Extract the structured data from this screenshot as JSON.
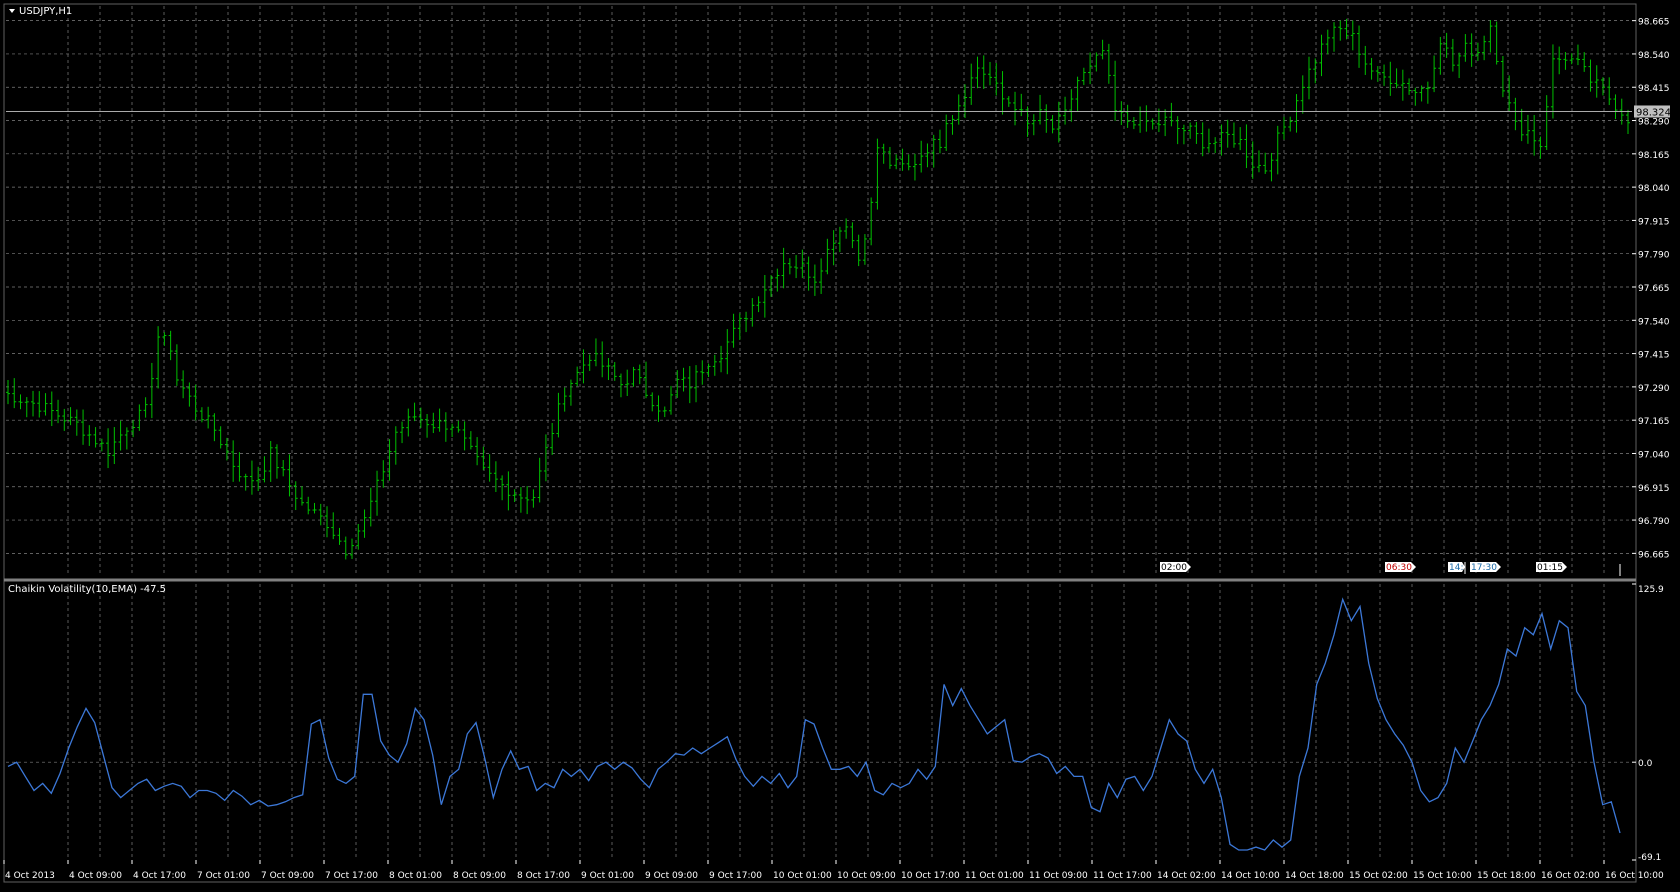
{
  "colors": {
    "background": "#000000",
    "grid": "#808080",
    "candle": "#00c000",
    "indicator": "#3c78d8",
    "text": "#ffffff",
    "bid_line": "#aaaaaa",
    "price_label_bg": "#c0c0c0"
  },
  "chart": {
    "title": "USDJPY,H1",
    "dropdown_icon": "triangle-down-icon",
    "current_price": "98.324"
  },
  "events": [
    "02:00",
    "06:30",
    "14:",
    "17:30",
    "01:15"
  ],
  "indicator": {
    "title": "Chaikin Volatility(10,EMA) -47.5"
  },
  "chart_data": [
    {
      "type": "bar",
      "title": "USDJPY,H1",
      "xlabel": "",
      "ylabel": "",
      "ylim": [
        96.58,
        98.72
      ],
      "y_ticks": [
        "98.665",
        "98.540",
        "98.415",
        "98.290",
        "98.165",
        "98.040",
        "97.915",
        "97.790",
        "97.665",
        "97.540",
        "97.415",
        "97.290",
        "97.165",
        "97.040",
        "96.915",
        "96.790",
        "96.665"
      ],
      "x_ticks": [
        "4 Oct 2013",
        "4 Oct 09:00",
        "4 Oct 17:00",
        "7 Oct 01:00",
        "7 Oct 09:00",
        "7 Oct 17:00",
        "8 Oct 01:00",
        "8 Oct 09:00",
        "8 Oct 17:00",
        "9 Oct 01:00",
        "9 Oct 09:00",
        "9 Oct 17:00",
        "10 Oct 01:00",
        "10 Oct 09:00",
        "10 Oct 17:00",
        "11 Oct 01:00",
        "11 Oct 09:00",
        "11 Oct 17:00",
        "14 Oct 02:00",
        "14 Oct 10:00",
        "14 Oct 18:00",
        "15 Oct 02:00",
        "15 Oct 10:00",
        "15 Oct 18:00",
        "16 Oct 02:00",
        "16 Oct 10:00"
      ],
      "grid": true,
      "series": [
        {
          "name": "USDJPY,H1",
          "close_path": [
            [
              0,
              97.27
            ],
            [
              6,
              97.22
            ],
            [
              12,
              97.15
            ],
            [
              17,
              97.05
            ],
            [
              20,
              97.14
            ],
            [
              23,
              97.2
            ],
            [
              25,
              97.48
            ],
            [
              27,
              97.44
            ],
            [
              28,
              97.32
            ],
            [
              31,
              97.21
            ],
            [
              34,
              97.13
            ],
            [
              37,
              97.0
            ],
            [
              39,
              96.94
            ],
            [
              41,
              96.95
            ],
            [
              43,
              97.04
            ],
            [
              46,
              96.92
            ],
            [
              48,
              96.85
            ],
            [
              52,
              96.78
            ],
            [
              55,
              96.68
            ],
            [
              58,
              96.79
            ],
            [
              61,
              96.98
            ],
            [
              63,
              97.12
            ],
            [
              66,
              97.18
            ],
            [
              69,
              97.15
            ],
            [
              72,
              97.15
            ],
            [
              74,
              97.08
            ],
            [
              77,
              96.97
            ],
            [
              80,
              96.92
            ],
            [
              83,
              96.88
            ],
            [
              85,
              96.88
            ],
            [
              87,
              97.05
            ],
            [
              90,
              97.28
            ],
            [
              92,
              97.34
            ],
            [
              94,
              97.41
            ],
            [
              97,
              97.35
            ],
            [
              99,
              97.3
            ],
            [
              101,
              97.34
            ],
            [
              103,
              97.27
            ],
            [
              106,
              97.19
            ],
            [
              108,
              97.31
            ],
            [
              110,
              97.3
            ],
            [
              113,
              97.39
            ],
            [
              115,
              97.42
            ],
            [
              118,
              97.53
            ],
            [
              121,
              97.63
            ],
            [
              123,
              97.7
            ],
            [
              125,
              97.76
            ],
            [
              128,
              97.74
            ],
            [
              130,
              97.7
            ],
            [
              133,
              97.85
            ],
            [
              135,
              97.91
            ],
            [
              137,
              97.77
            ],
            [
              139,
              97.97
            ],
            [
              140,
              98.19
            ],
            [
              142,
              98.13
            ],
            [
              145,
              98.11
            ],
            [
              148,
              98.19
            ],
            [
              150,
              98.21
            ],
            [
              151,
              98.3
            ],
            [
              152,
              98.31
            ],
            [
              154,
              98.4
            ],
            [
              156,
              98.49
            ],
            [
              158,
              98.45
            ],
            [
              160,
              98.37
            ],
            [
              162,
              98.35
            ],
            [
              164,
              98.27
            ],
            [
              166,
              98.31
            ],
            [
              168,
              98.26
            ],
            [
              170,
              98.31
            ],
            [
              172,
              98.44
            ],
            [
              174,
              98.48
            ],
            [
              176,
              98.55
            ],
            [
              178,
              98.32
            ],
            [
              180,
              98.29
            ],
            [
              182,
              98.3
            ],
            [
              184,
              98.27
            ],
            [
              186,
              98.29
            ],
            [
              188,
              98.26
            ],
            [
              190,
              98.25
            ],
            [
              192,
              98.21
            ],
            [
              194,
              98.21
            ],
            [
              196,
              98.23
            ],
            [
              198,
              98.21
            ],
            [
              200,
              98.13
            ],
            [
              202,
              98.11
            ],
            [
              204,
              98.22
            ],
            [
              206,
              98.31
            ],
            [
              208,
              98.43
            ],
            [
              210,
              98.52
            ],
            [
              212,
              98.61
            ],
            [
              214,
              98.63
            ],
            [
              216,
              98.6
            ],
            [
              218,
              98.51
            ],
            [
              220,
              98.45
            ],
            [
              222,
              98.45
            ],
            [
              224,
              98.43
            ],
            [
              226,
              98.4
            ],
            [
              228,
              98.42
            ],
            [
              230,
              98.6
            ],
            [
              232,
              98.5
            ],
            [
              234,
              98.56
            ],
            [
              236,
              98.55
            ],
            [
              238,
              98.65
            ],
            [
              240,
              98.42
            ],
            [
              242,
              98.27
            ],
            [
              244,
              98.25
            ],
            [
              246,
              98.2
            ],
            [
              248,
              98.51
            ],
            [
              250,
              98.53
            ],
            [
              252,
              98.5
            ],
            [
              254,
              98.44
            ],
            [
              256,
              98.4
            ],
            [
              258,
              98.35
            ],
            [
              260,
              98.3
            ]
          ]
        }
      ],
      "bid": 98.324
    },
    {
      "type": "line",
      "title": "Chaikin Volatility(10,EMA) -47.5",
      "ylim": [
        -69.1,
        125.9
      ],
      "y_ticks": [
        "125.9",
        "0.0",
        "-69.1"
      ],
      "series": [
        {
          "name": "Chaikin Volatility(10,EMA) -47.5",
          "values": [
            -3,
            0,
            -10,
            -20,
            -15,
            -22,
            -8,
            10,
            25,
            38,
            28,
            5,
            -18,
            -25,
            -20,
            -15,
            -12,
            -20,
            -17,
            -15,
            -17,
            -25,
            -20,
            -20,
            -22,
            -27,
            -20,
            -24,
            -30,
            -27,
            -31,
            -30,
            -28,
            -25,
            -23,
            27,
            30,
            3,
            -12,
            -15,
            -10,
            48,
            48,
            15,
            5,
            0,
            13,
            38,
            30,
            5,
            -30,
            -10,
            -5,
            20,
            28,
            3,
            -25,
            -5,
            8,
            -5,
            -3,
            -20,
            -15,
            -18,
            -5,
            -10,
            -5,
            -13,
            -3,
            0,
            -5,
            0,
            -4,
            -12,
            -18,
            -5,
            0,
            6,
            5,
            10,
            6,
            10,
            14,
            18,
            2,
            -10,
            -17,
            -10,
            -15,
            -8,
            -18,
            -10,
            30,
            27,
            10,
            -5,
            -5,
            -3,
            -10,
            0,
            -20,
            -23,
            -15,
            -18,
            -15,
            -5,
            -12,
            -3,
            55,
            40,
            52,
            40,
            30,
            20,
            25,
            30,
            1,
            0,
            4,
            6,
            3,
            -8,
            -3,
            -10,
            -10,
            -32,
            -35,
            -15,
            -25,
            -12,
            -10,
            -20,
            -10,
            10,
            30,
            20,
            15,
            -5,
            -15,
            -5,
            -25,
            -58,
            -62,
            -62,
            -60,
            -62,
            -55,
            -60,
            -55,
            -10,
            10,
            55,
            70,
            90,
            115,
            100,
            110,
            70,
            45,
            30,
            20,
            12,
            0,
            -20,
            -28,
            -25,
            -15,
            10,
            0,
            15,
            30,
            40,
            55,
            80,
            75,
            95,
            90,
            105,
            80,
            100,
            95,
            50,
            40,
            0,
            -30,
            -28,
            -50
          ]
        }
      ]
    }
  ]
}
